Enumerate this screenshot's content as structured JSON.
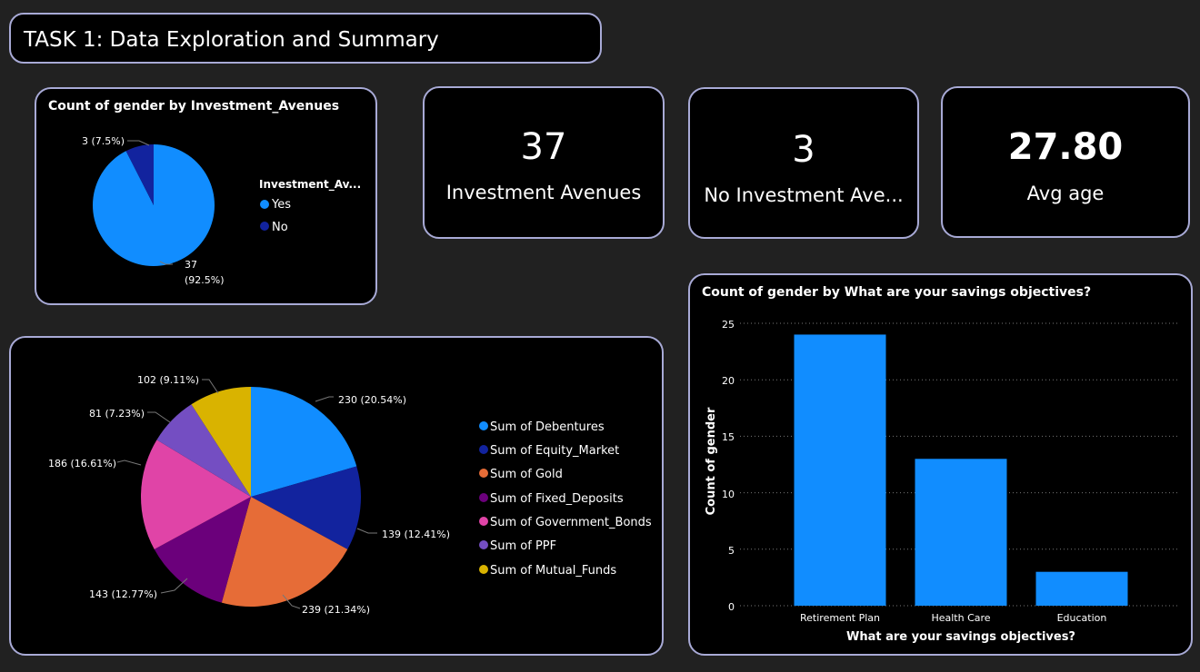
{
  "page_title": "TASK 1: Data Exploration and Summary",
  "kpis": [
    {
      "value": "37",
      "label": "Investment Avenues"
    },
    {
      "value": "3",
      "label": "No Investment Ave..."
    },
    {
      "value": "27.80",
      "label": "Avg age"
    }
  ],
  "colors": {
    "background": "#212121",
    "card": "#000000",
    "card_border": "#a8aad6",
    "blue": "#118dff",
    "navy": "#12239e",
    "orange": "#e66c37",
    "purple": "#6b007b",
    "pink": "#e044a7",
    "violet": "#744ec2",
    "gold": "#d9b300"
  },
  "chart_data": [
    {
      "type": "pie",
      "title": "Count of gender by Investment_Avenues",
      "legend_title": "Investment_Av...",
      "legend_position": "right",
      "slices": [
        {
          "label": "Yes",
          "value": 37,
          "data_label": "37 (92.5%)",
          "data_label_line1": "37",
          "data_label_line2": "(92.5%)",
          "color": "#118dff"
        },
        {
          "label": "No",
          "value": 3,
          "data_label": "3 (7.5%)",
          "color": "#12239e"
        }
      ]
    },
    {
      "type": "pie",
      "title": "",
      "legend_position": "right",
      "slices": [
        {
          "label": "Sum of Debentures",
          "value": 230,
          "data_label": "230 (20.54%)",
          "color": "#118dff"
        },
        {
          "label": "Sum of Equity_Market",
          "value": 139,
          "data_label": "139 (12.41%)",
          "color": "#12239e"
        },
        {
          "label": "Sum of Gold",
          "value": 239,
          "data_label": "239 (21.34%)",
          "color": "#e66c37"
        },
        {
          "label": "Sum of Fixed_Deposits",
          "value": 143,
          "data_label": "143 (12.77%)",
          "color": "#6b007b"
        },
        {
          "label": "Sum of Government_Bonds",
          "value": 186,
          "data_label": "186 (16.61%)",
          "color": "#e044a7"
        },
        {
          "label": "Sum of PPF",
          "value": 81,
          "data_label": "81 (7.23%)",
          "color": "#744ec2"
        },
        {
          "label": "Sum of Mutual_Funds",
          "value": 102,
          "data_label": "102 (9.11%)",
          "color": "#d9b300"
        }
      ]
    },
    {
      "type": "bar",
      "title": "Count of gender by What are your savings objectives?",
      "categories": [
        "Retirement Plan",
        "Health Care",
        "Education"
      ],
      "values": [
        24,
        13,
        3
      ],
      "xlabel": "What are your savings objectives?",
      "ylabel": "Count of gender",
      "ylim": [
        0,
        25
      ],
      "yticks": [
        "0",
        "5",
        "10",
        "15",
        "20",
        "25"
      ],
      "grid": true,
      "color": "#118dff"
    }
  ]
}
